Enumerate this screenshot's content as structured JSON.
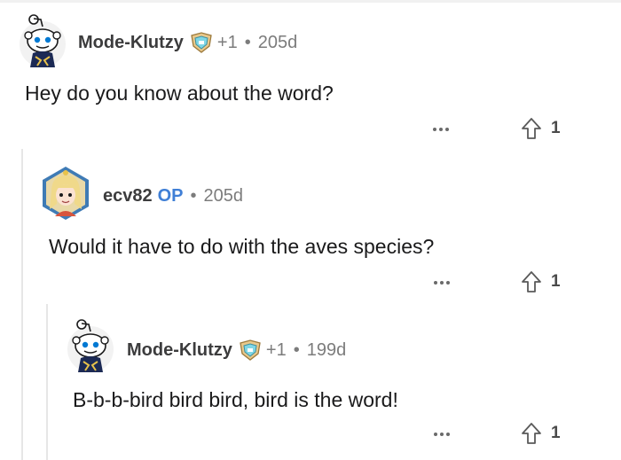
{
  "colors": {
    "op_badge": "#3f7fd6",
    "text": "#1a1a1b",
    "muted": "#7c7c7c",
    "thread_line": "#e6e6e6"
  },
  "comments": [
    {
      "username": "Mode-Klutzy",
      "avatar_icon": "snoo-avatar-icon",
      "award_icon": "award-badge-icon",
      "karma": "+1",
      "separator": "•",
      "age": "205d",
      "body": "Hey do you know about the word?",
      "more_icon": "more-options-icon",
      "vote_icon": "upvote-arrow-icon",
      "votes": "1"
    },
    {
      "username": "ecv82",
      "op_label": "OP",
      "avatar_icon": "anime-character-avatar-icon",
      "separator": "•",
      "age": "205d",
      "body": "Would it have to do with the aves species?",
      "more_icon": "more-options-icon",
      "vote_icon": "upvote-arrow-icon",
      "votes": "1"
    },
    {
      "username": "Mode-Klutzy",
      "avatar_icon": "snoo-avatar-icon",
      "award_icon": "award-badge-icon",
      "karma": "+1",
      "separator": "•",
      "age": "199d",
      "body": "B-b-b-bird bird bird, bird is the word!",
      "more_icon": "more-options-icon",
      "vote_icon": "upvote-arrow-icon",
      "votes": "1"
    }
  ]
}
